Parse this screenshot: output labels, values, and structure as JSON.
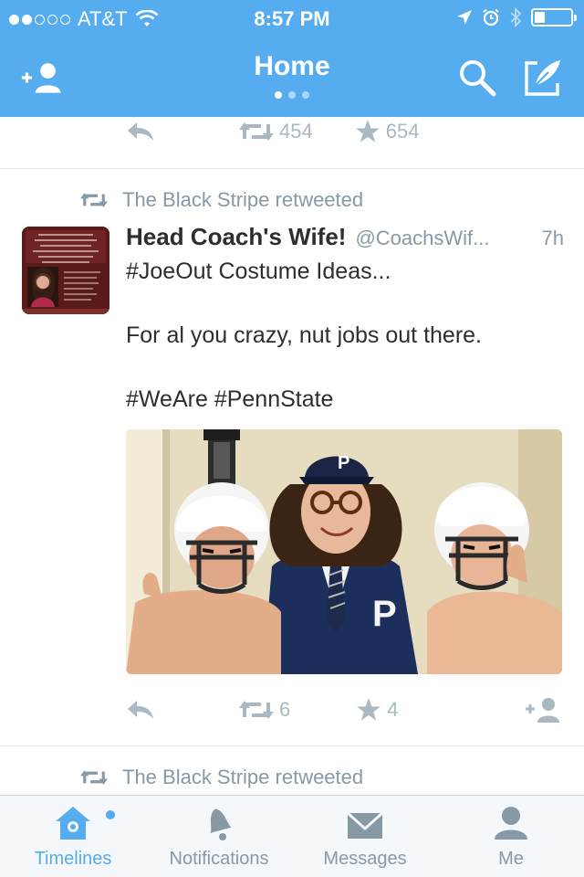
{
  "status_bar": {
    "carrier": "AT&T",
    "time": "8:57 PM",
    "signal_bars_filled": 2,
    "signal_bars_total": 5,
    "battery_level": 0.3
  },
  "header": {
    "title": "Home",
    "page_count": 3,
    "active_page": 1,
    "left_icon": "add-user-icon",
    "right_icons": [
      "search-icon",
      "compose-icon"
    ]
  },
  "colors": {
    "brand": "#55acee",
    "meta_text": "#8899a6",
    "action_icon": "#aab8c2"
  },
  "timeline": {
    "prev_tweet_actions": {
      "retweets": "454",
      "favorites": "654"
    },
    "tweet": {
      "retweeted_by": "The Black Stripe retweeted",
      "name": "Head Coach's Wife!",
      "handle": "@CoachsWif...",
      "time": "7h",
      "text": "#JoeOut Costume Ideas...\n\nFor al you crazy, nut jobs out there.\n\n#WeAre #PennState",
      "retweets": "6",
      "favorites": "4",
      "media": {
        "helmet_logo": "P",
        "jacket_logo": "P"
      }
    },
    "next_tweet": {
      "retweeted_by": "The Black Stripe retweeted"
    }
  },
  "tabbar": {
    "tabs": [
      {
        "label": "Timelines",
        "icon": "home-icon",
        "active": true,
        "has_badge": true
      },
      {
        "label": "Notifications",
        "icon": "bell-icon",
        "active": false
      },
      {
        "label": "Messages",
        "icon": "envelope-icon",
        "active": false
      },
      {
        "label": "Me",
        "icon": "person-icon",
        "active": false
      }
    ]
  }
}
